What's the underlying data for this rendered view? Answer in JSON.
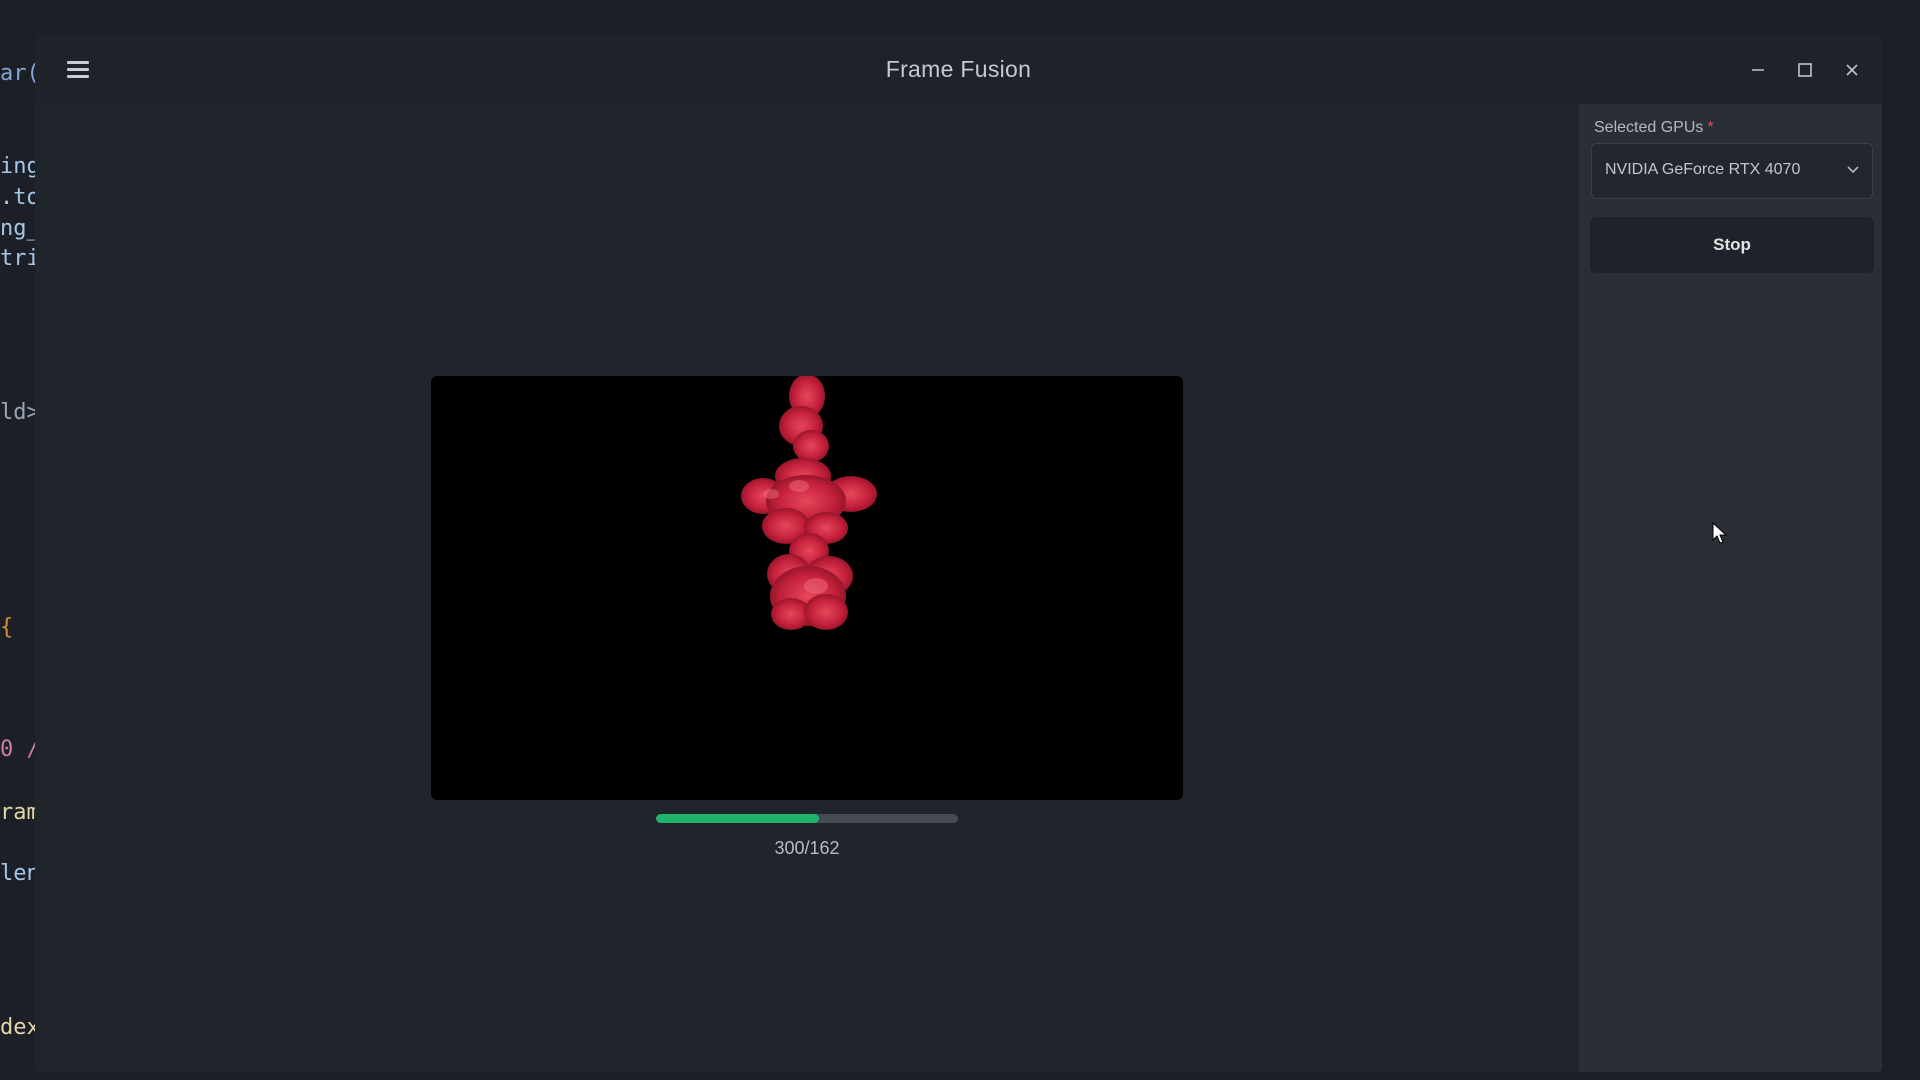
{
  "editor": {
    "lines": [
      {
        "text": "ar(",
        "color": "#7fa7d6"
      },
      {
        "text": "ing",
        "color": "#a3c7e8"
      },
      {
        "text": ".to",
        "color": "#a3c7e8"
      },
      {
        "text": "ng_",
        "color": "#a3c7e8"
      },
      {
        "text": "tri",
        "color": "#a3c7e8"
      },
      {
        "text": "ld>",
        "color": "#9aa5b5"
      },
      {
        "text": "{",
        "color": "#d28b3a"
      },
      {
        "text": "0 /",
        "color": "#c97fa0"
      },
      {
        "text": "ram",
        "color": "#e0d6a8"
      },
      {
        "text": "len",
        "color": "#a3c7e8"
      },
      {
        "text": "dex",
        "color": "#e0d6a8"
      }
    ]
  },
  "window": {
    "title": "Frame Fusion",
    "icons": {
      "menu": "hamburger-menu-icon",
      "minimize": "minimize-icon",
      "maximize": "maximize-icon",
      "close": "close-icon"
    }
  },
  "player": {
    "progress": {
      "fraction": 0.54,
      "text": "300/162",
      "fill_color": "#1fb36b"
    }
  },
  "sidebar": {
    "gpu_label": "Selected GPUs",
    "required_marker": "*",
    "gpu_value": "NVIDIA GeForce RTX 4070",
    "stop_label": "Stop"
  }
}
